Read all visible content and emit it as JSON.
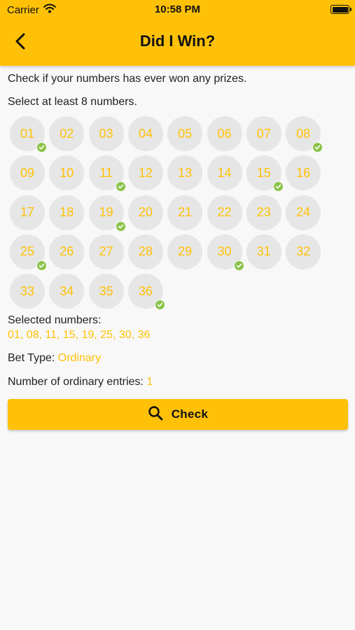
{
  "status_bar": {
    "carrier": "Carrier",
    "time": "10:58 PM"
  },
  "header": {
    "title": "Did I Win?",
    "back_icon": "chevron-left-icon"
  },
  "intro_text": "Check if your numbers has ever won any prizes.",
  "instruction_text": "Select at least 8 numbers.",
  "numbers": [
    {
      "label": "01",
      "selected": true
    },
    {
      "label": "02",
      "selected": false
    },
    {
      "label": "03",
      "selected": false
    },
    {
      "label": "04",
      "selected": false
    },
    {
      "label": "05",
      "selected": false
    },
    {
      "label": "06",
      "selected": false
    },
    {
      "label": "07",
      "selected": false
    },
    {
      "label": "08",
      "selected": true
    },
    {
      "label": "09",
      "selected": false
    },
    {
      "label": "10",
      "selected": false
    },
    {
      "label": "11",
      "selected": true
    },
    {
      "label": "12",
      "selected": false
    },
    {
      "label": "13",
      "selected": false
    },
    {
      "label": "14",
      "selected": false
    },
    {
      "label": "15",
      "selected": true
    },
    {
      "label": "16",
      "selected": false
    },
    {
      "label": "17",
      "selected": false
    },
    {
      "label": "18",
      "selected": false
    },
    {
      "label": "19",
      "selected": true
    },
    {
      "label": "20",
      "selected": false
    },
    {
      "label": "21",
      "selected": false
    },
    {
      "label": "22",
      "selected": false
    },
    {
      "label": "23",
      "selected": false
    },
    {
      "label": "24",
      "selected": false
    },
    {
      "label": "25",
      "selected": true
    },
    {
      "label": "26",
      "selected": false
    },
    {
      "label": "27",
      "selected": false
    },
    {
      "label": "28",
      "selected": false
    },
    {
      "label": "29",
      "selected": false
    },
    {
      "label": "30",
      "selected": true
    },
    {
      "label": "31",
      "selected": false
    },
    {
      "label": "32",
      "selected": false
    },
    {
      "label": "33",
      "selected": false
    },
    {
      "label": "34",
      "selected": false
    },
    {
      "label": "35",
      "selected": false
    },
    {
      "label": "36",
      "selected": true
    }
  ],
  "summary": {
    "selected_label": "Selected numbers:",
    "selected_values": "01, 08, 11, 15, 19, 25, 30, 36",
    "bet_type_label": "Bet Type: ",
    "bet_type_value": "Ordinary",
    "entries_label": "Number of ordinary entries: ",
    "entries_value": "1"
  },
  "check_button": {
    "label": "Check",
    "icon": "search-icon"
  },
  "colors": {
    "accent": "#FFC107",
    "check": "#8BC34A",
    "ball": "#e6e6e6",
    "background": "#f8f8f8"
  }
}
